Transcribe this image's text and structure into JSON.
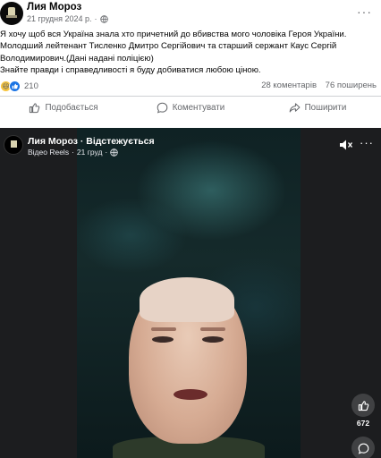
{
  "post": {
    "author": "Лия Мороз",
    "date": "21 грудня 2024 р.",
    "date_separator": "·",
    "more_label": "···",
    "lines": [
      "Я хочу щоб вся Україна знала хто причетний до вбивства мого чоловіка Героя України.",
      "Молодший лейтенант Тисленко Дмитро Сергійович та старший сержант Каус Сергій",
      "Володимирович.(Дані надані поліцією)",
      "Знайте правди і справедливості я буду добиватися любою ціною."
    ],
    "reaction_count": "210",
    "comments": "28 коментарів",
    "shares": "76 поширень"
  },
  "actions": {
    "like": "Подобається",
    "comment": "Коментувати",
    "share": "Поширити"
  },
  "reel": {
    "author": "Лия Мороз",
    "follow_sep": " · ",
    "follow": "Відстежується",
    "source": "Відео Reels",
    "time": "21 груд",
    "meta_sep": "·",
    "more_label": "···",
    "like_count": "672"
  },
  "colors": {
    "secondary_text": "#65676b",
    "divider": "#ced0d4",
    "like_blue": "#1b74e4",
    "haha_yellow": "#f7c53f"
  }
}
